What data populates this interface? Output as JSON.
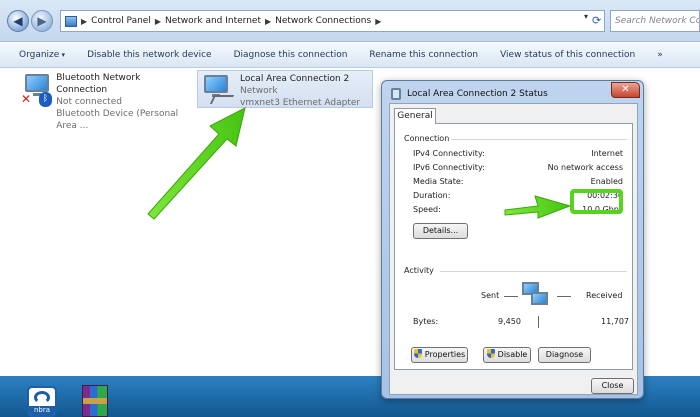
{
  "addressbar": {
    "breadcrumbs": [
      "Control Panel",
      "Network and Internet",
      "Network Connections"
    ],
    "search_placeholder": "Search Network Connections"
  },
  "commandbar": {
    "organize": "Organize",
    "disable": "Disable this network device",
    "diagnose": "Diagnose this connection",
    "rename": "Rename this connection",
    "view_status": "View status of this connection",
    "more": "»"
  },
  "connections": [
    {
      "name": "Bluetooth Network Connection",
      "status": "Not connected",
      "device": "Bluetooth Device (Personal Area ..."
    },
    {
      "name": "Local Area Connection 2",
      "status": "Network",
      "device": "vmxnet3 Ethernet Adapter"
    }
  ],
  "dialog": {
    "title": "Local Area Connection 2 Status",
    "tab": "General",
    "connection_label": "Connection",
    "rows": [
      {
        "k": "IPv4 Connectivity:",
        "v": "Internet"
      },
      {
        "k": "IPv6 Connectivity:",
        "v": "No network access"
      },
      {
        "k": "Media State:",
        "v": "Enabled"
      },
      {
        "k": "Duration:",
        "v": "00:02:30"
      },
      {
        "k": "Speed:",
        "v": "10.0 Gbps"
      }
    ],
    "details_btn": "Details...",
    "activity_label": "Activity",
    "sent_label": "Sent",
    "received_label": "Received",
    "bytes_label": "Bytes:",
    "bytes_sent": "9,450",
    "bytes_received": "11,707",
    "properties_btn": "Properties",
    "disable_btn": "Disable",
    "diagnose_btn": "Diagnose",
    "close_btn": "Close"
  },
  "desktop": {
    "nimbra_label": "nbra"
  },
  "colors": {
    "highlight_green": "#56d41f",
    "title_blue": "#1e395b"
  },
  "icons": [
    "back-arrow-icon",
    "forward-arrow-icon",
    "control-panel-icon",
    "refresh-icon",
    "network-adapter-icon",
    "bluetooth-icon",
    "disconnected-x-icon",
    "shield-icon",
    "close-x-icon"
  ]
}
